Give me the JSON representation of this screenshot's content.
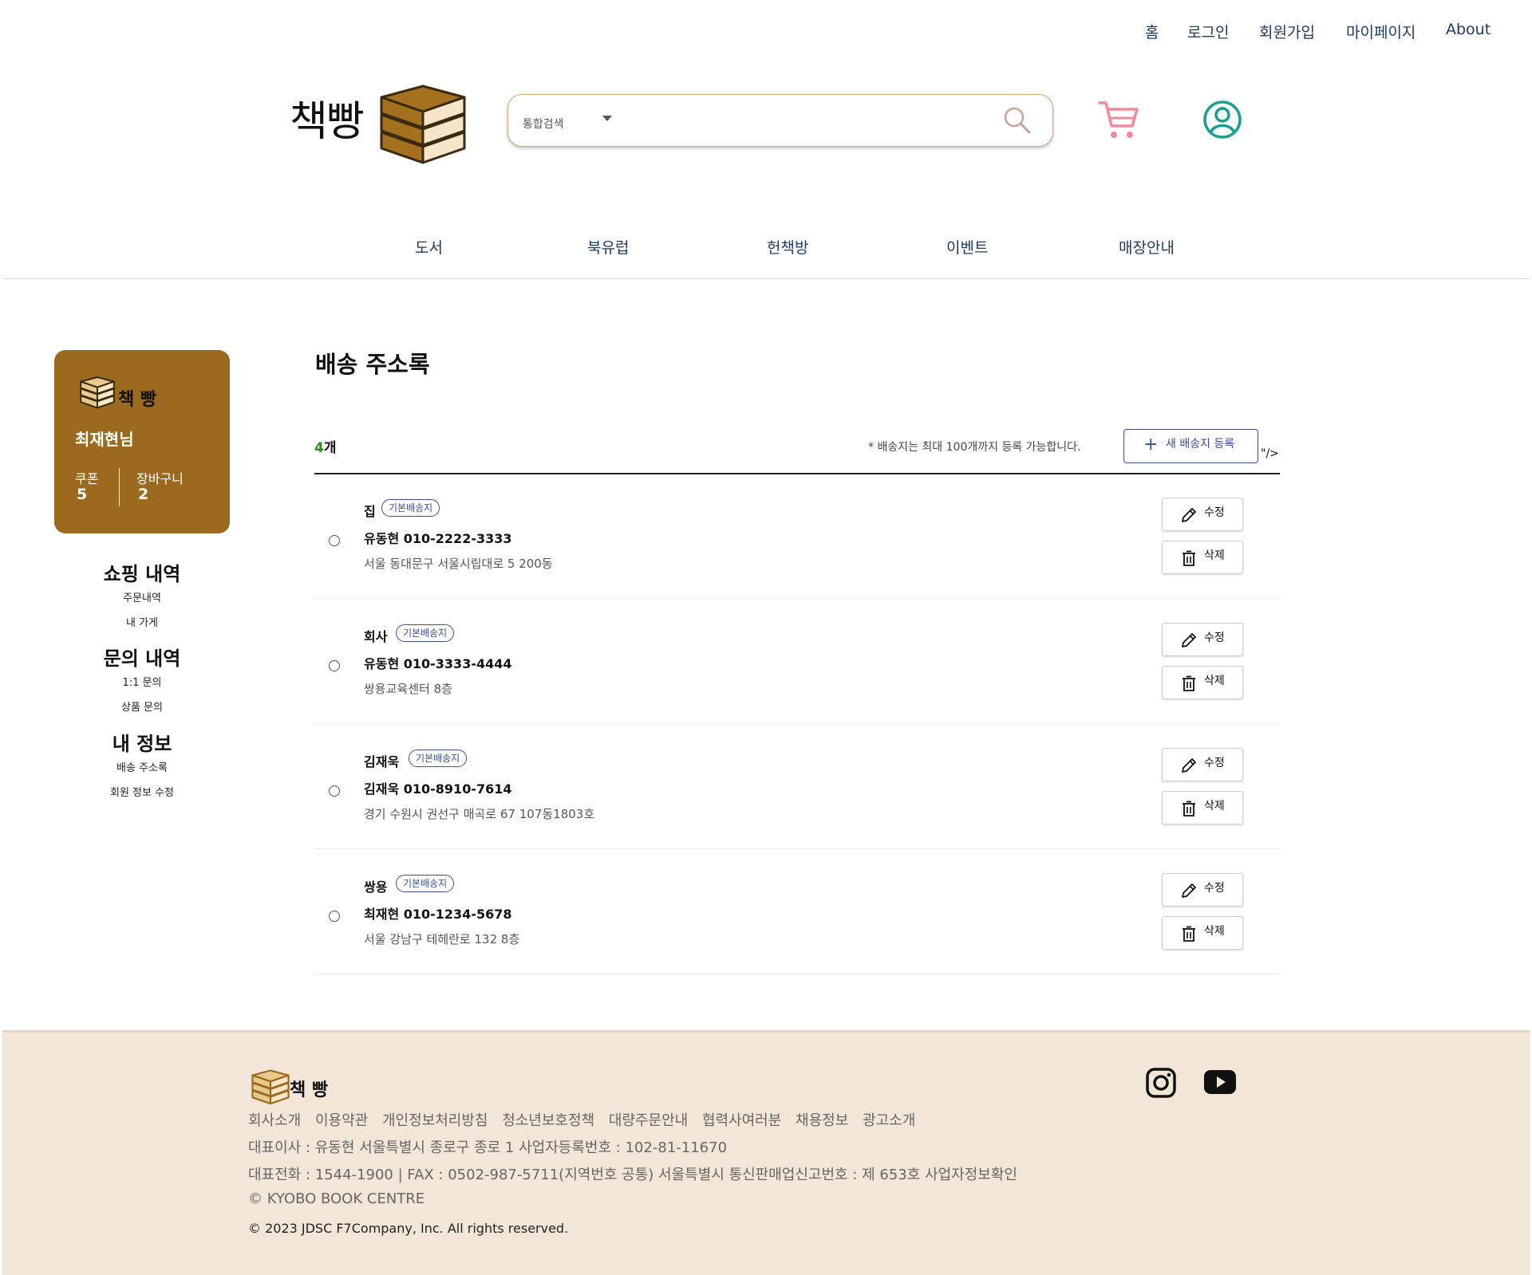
{
  "top_nav": [
    "홈",
    "로그인",
    "회원가입",
    "마이페이지",
    "About"
  ],
  "logo": {
    "text": "책빵"
  },
  "search": {
    "category": "통합검색",
    "placeholder": ""
  },
  "main_nav": [
    "도서",
    "북유럽",
    "헌책방",
    "이벤트",
    "매장안내"
  ],
  "profile_card": {
    "brand": "책 빵",
    "user": "최재현님",
    "coupon_label": "쿠폰",
    "coupon_count": "5",
    "cart_label": "장바구니",
    "cart_count": "2"
  },
  "side_menu": [
    {
      "heading": "쇼핑 내역",
      "items": [
        "주문내역",
        "내 가게"
      ]
    },
    {
      "heading": "문의 내역",
      "items": [
        "1:1 문의",
        "상품 문의"
      ]
    },
    {
      "heading": "내 정보",
      "items": [
        "배송 주소록",
        "회원 정보 수정"
      ]
    }
  ],
  "page_title": "배송 주소록",
  "count": {
    "number": "4",
    "unit": "개"
  },
  "notice": "* 배송지는 최대 100개까지 등록 가능합니다.",
  "new_button": "새 배송지 등록",
  "stray_text": "\"/>",
  "badge_label": "기본배송지",
  "edit_label": "수정",
  "delete_label": "삭제",
  "addresses": [
    {
      "name": "집",
      "recipient": "유동현",
      "phone": "010-2222-3333",
      "address": "서울 동대문구 서울시립대로 5 200동"
    },
    {
      "name": "회사",
      "recipient": "유동현",
      "phone": "010-3333-4444",
      "address": "쌍용교육센터 8층"
    },
    {
      "name": "김재욱",
      "recipient": "김재욱",
      "phone": "010-8910-7614",
      "address": "경기 수원시 권선구 매곡로 67 107동1803호"
    },
    {
      "name": "쌍용",
      "recipient": "최재현",
      "phone": "010-1234-5678",
      "address": "서울 강남구 테헤란로 132 8층"
    }
  ],
  "footer": {
    "brand": "책 빵",
    "links": [
      "회사소개",
      "이용약관",
      "개인정보처리방침",
      "청소년보호정책",
      "대량주문안내",
      "협력사여러분",
      "채용정보",
      "광고소개"
    ],
    "line1": "대표이사 : 유동현 서울특별시 종로구 종로 1 사업자등록번호 : 102-81-11670",
    "line2": "대표전화 : 1544-1900 | FAX : 0502-987-5711(지역번호 공통) 서울특별시 통신판매업신고번호 : 제 653호 사업자정보확인",
    "line3": "© KYOBO BOOK CENTRE",
    "copyright": "© 2023 JDSC F7Company, Inc. All rights reserved."
  },
  "colors": {
    "brand_brown": "#9b6a1e",
    "nav_text": "#1f3a5f",
    "cart_pink": "#f08a9c",
    "user_teal": "#1a9e8f",
    "footer_bg": "#f1e6d7",
    "accent_blue": "#3b4f96",
    "count_green": "#2e8b1e"
  }
}
